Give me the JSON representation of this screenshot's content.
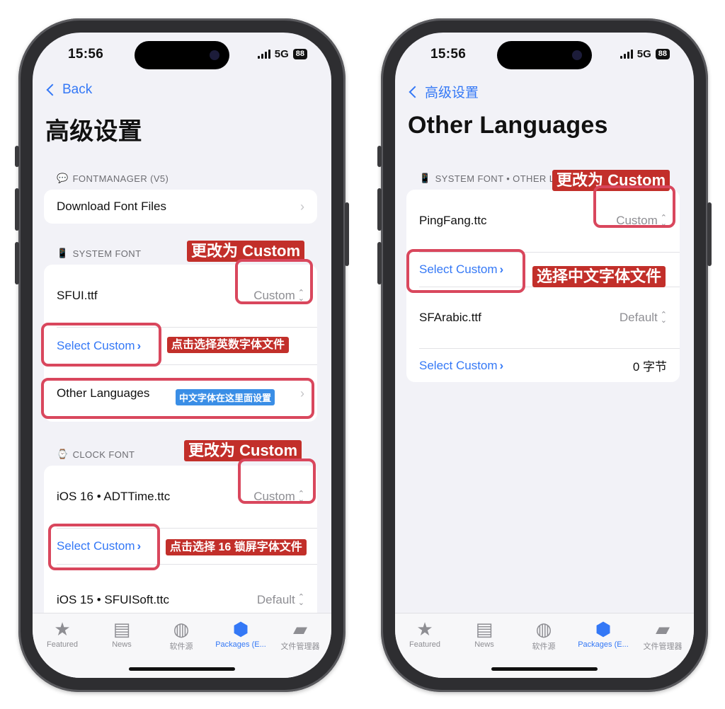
{
  "status": {
    "time": "15:56",
    "network": "5G",
    "battery": "88"
  },
  "left_screen": {
    "back_label": "Back",
    "title": "高级设置",
    "fontmanager": {
      "header": "FONTMANAGER (V5)",
      "header_icon": "speech-bubble-icon",
      "download_label": "Download Font Files"
    },
    "system_font": {
      "header": "SYSTEM FONT",
      "header_icon": "phone-icon",
      "file_label": "SFUI.ttf",
      "value": "Custom",
      "select_label": "Select Custom",
      "other_languages_label": "Other Languages"
    },
    "clock_font": {
      "header": "CLOCK FONT",
      "header_icon": "watch-icon",
      "ios16_label": "iOS 16 • ADTTime.ttc",
      "ios16_value": "Custom",
      "select_label": "Select Custom",
      "ios15_label": "iOS 15 • SFUISoft.ttc",
      "ios15_value": "Default"
    },
    "annotations": {
      "change_custom_1": "更改为 Custom",
      "select_alnum_font": "点击选择英数字体文件",
      "chinese_here": "中文字体在这里面设置",
      "change_custom_2": "更改为 Custom",
      "select_lock_font": "点击选择 16 锁屏字体文件"
    }
  },
  "right_screen": {
    "back_label": "高级设置",
    "title": "Other Languages",
    "section": {
      "header": "SYSTEM FONT • OTHER LA",
      "header_icon": "phone-icon",
      "pingfang_label": "PingFang.ttc",
      "pingfang_value": "Custom",
      "select_label_1": "Select Custom",
      "sfarabic_label": "SFArabic.ttf",
      "sfarabic_value": "Default",
      "select_label_2": "Select Custom",
      "size_value": "0 字节"
    },
    "annotations": {
      "change_custom": "更改为 Custom",
      "select_chinese_font": "选择中文字体文件"
    }
  },
  "tabbar": {
    "tabs": [
      {
        "label": "Featured",
        "icon": "star-icon"
      },
      {
        "label": "News",
        "icon": "newspaper-icon"
      },
      {
        "label": "软件源",
        "icon": "globe-icon"
      },
      {
        "label": "Packages (E...",
        "icon": "package-icon"
      },
      {
        "label": "文件管理器",
        "icon": "folder-plus-icon"
      }
    ],
    "active_index": 3
  },
  "colors": {
    "accent": "#3478f6",
    "highlight": "#d9475d",
    "tag_red": "#c22f2a",
    "tag_blue": "#3a8ee6"
  }
}
